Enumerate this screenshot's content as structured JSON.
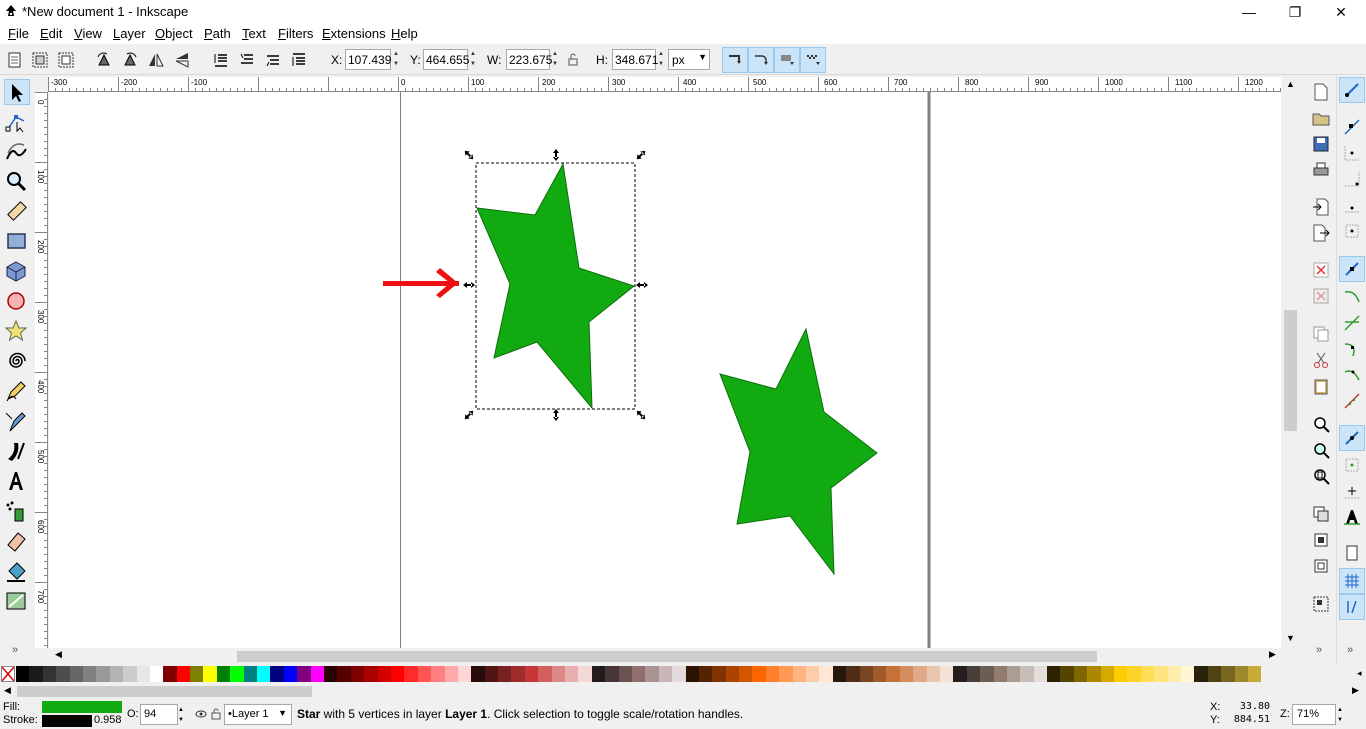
{
  "window": {
    "title": "*New document 1 - Inkscape",
    "minimize_glyph": "—",
    "restore_glyph": "❐",
    "close_glyph": "✕"
  },
  "menu": [
    "File",
    "Edit",
    "View",
    "Layer",
    "Object",
    "Path",
    "Text",
    "Filters",
    "Extensions",
    "Help"
  ],
  "toolbar": {
    "x_label": "X:",
    "x_value": "107.439",
    "y_label": "Y:",
    "y_value": "464.655",
    "w_label": "W:",
    "w_value": "223.675",
    "h_label": "H:",
    "h_value": "348.671",
    "unit": "px"
  },
  "ruler": {
    "h_labels": [
      "-300",
      "-200",
      "-100",
      "0",
      "100",
      "200",
      "300",
      "400",
      "500",
      "600",
      "700",
      "800",
      "900",
      "1000",
      "1100",
      "1200"
    ],
    "v_labels": [
      "0",
      "100",
      "200",
      "300",
      "400",
      "500",
      "600",
      "700"
    ]
  },
  "canvas": {
    "page_border_color": "#808080",
    "star_fill": "#11aa11",
    "star_stroke": "#0d6e0d",
    "arrow_color": "#ee1111"
  },
  "palette": {
    "colors": [
      "#000000",
      "#1a1a1a",
      "#333333",
      "#4d4d4d",
      "#666666",
      "#808080",
      "#999999",
      "#b3b3b3",
      "#cccccc",
      "#e6e6e6",
      "#ffffff",
      "#800000",
      "#ff0000",
      "#808000",
      "#ffff00",
      "#008000",
      "#00ff00",
      "#008080",
      "#00ffff",
      "#000080",
      "#0000ff",
      "#800080",
      "#ff00ff",
      "#2b0000",
      "#550000",
      "#800000",
      "#aa0000",
      "#d40000",
      "#ff0000",
      "#ff2a2a",
      "#ff5555",
      "#ff8080",
      "#ffaaaa",
      "#ffd5d5",
      "#280b0b",
      "#501616",
      "#782121",
      "#a02c2c",
      "#c83737",
      "#d35f5f",
      "#de8787",
      "#e9afaf",
      "#f4d7d7",
      "#241c1c",
      "#483737",
      "#6c5353",
      "#916f6f",
      "#ac9393",
      "#c8b7b7",
      "#e3dbdb",
      "#2b1100",
      "#552200",
      "#803300",
      "#aa4400",
      "#d45500",
      "#ff6600",
      "#ff7f2a",
      "#ff9955",
      "#ffb380",
      "#ffccaa",
      "#ffe6d5",
      "#28170b",
      "#502d16",
      "#784421",
      "#a05a2c",
      "#c87137",
      "#d38d5f",
      "#deaa87",
      "#e9c6af",
      "#f4e3d7",
      "#241f1c",
      "#483e37",
      "#6c5d53",
      "#917c6f",
      "#ac9d93",
      "#c8beb7",
      "#e3dedb",
      "#2b2200",
      "#554400",
      "#806600",
      "#aa8800",
      "#d4aa00",
      "#ffcc00",
      "#ffd42a",
      "#ffdd55",
      "#ffe680",
      "#ffeeaa",
      "#fff6d5",
      "#28220b",
      "#504416",
      "#786721",
      "#a0892c",
      "#c8ab37"
    ]
  },
  "status": {
    "fill_label": "Fill:",
    "stroke_label": "Stroke:",
    "fill_color": "#11aa11",
    "stroke_color": "#000000",
    "stroke_width": "0.958",
    "opacity_label": "O:",
    "opacity_value": "94",
    "layer": "•Layer 1",
    "message_bold1": "Star",
    "message_part1": " with 5 vertices in layer ",
    "message_bold2": "Layer 1",
    "message_part2": ". Click selection to toggle scale/rotation handles.",
    "cursor_x_label": "X:",
    "cursor_x": "33.80",
    "cursor_y_label": "Y:",
    "cursor_y": "884.51",
    "zoom_label": "Z:",
    "zoom": "71%"
  }
}
